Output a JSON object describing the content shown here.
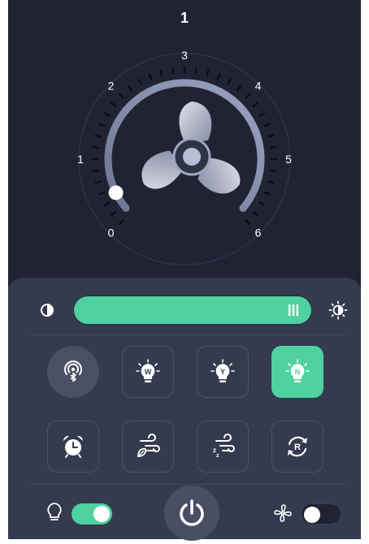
{
  "speed": {
    "current": "1",
    "level": 0.07,
    "labels": [
      "0",
      "1",
      "2",
      "3",
      "4",
      "5",
      "6"
    ]
  },
  "brightness": {
    "level": 1.0,
    "low_icon": "half-circle-icon",
    "high_icon": "sun-icon",
    "handle_icon": "grip-lines-icon"
  },
  "light_buttons": [
    {
      "name": "bluetooth-button",
      "icon": "bluetooth-signal-icon",
      "letter": "",
      "active": false,
      "round": true
    },
    {
      "name": "warm-light-button",
      "icon": "bulb-icon",
      "letter": "W",
      "active": false
    },
    {
      "name": "yellow-light-button",
      "icon": "bulb-icon",
      "letter": "Y",
      "active": false
    },
    {
      "name": "neutral-light-button",
      "icon": "bulb-icon",
      "letter": "N",
      "active": true
    }
  ],
  "fan_buttons": [
    {
      "name": "timer-button",
      "icon": "alarm-clock-icon"
    },
    {
      "name": "natural-wind-button",
      "icon": "leaf-wind-icon"
    },
    {
      "name": "sleep-wind-button",
      "icon": "sleep-wind-icon"
    },
    {
      "name": "reverse-button",
      "icon": "reverse-rotation-icon",
      "letter": "R"
    }
  ],
  "bottom": {
    "light_toggle_on": true,
    "fan_toggle_on": false,
    "light_icon": "bulb-outline-icon",
    "fan_icon": "fan-icon",
    "power_icon": "power-icon"
  },
  "colors": {
    "accent": "#4fd2a0",
    "background": "#1f2333",
    "panel": "#343b4f"
  }
}
